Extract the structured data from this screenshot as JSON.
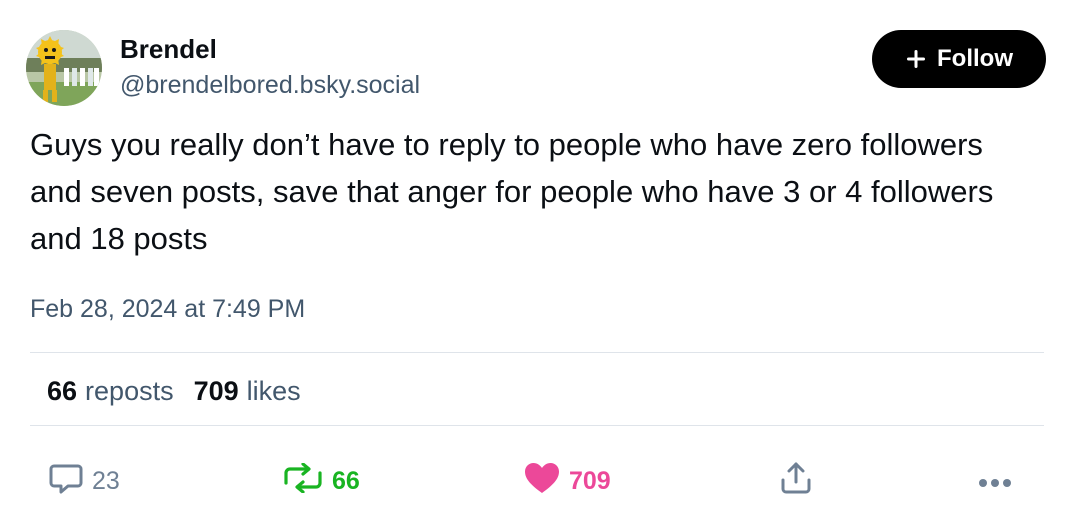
{
  "author": {
    "display_name": "Brendel",
    "handle": "@brendelbored.bsky.social",
    "avatar_icon": "avatar-image"
  },
  "follow_button": {
    "label": "Follow",
    "icon": "plus-icon"
  },
  "post": {
    "text": "Guys you really don’t have to reply to people who have zero followers and seven posts, save that anger for people who have 3 or 4 followers and 18 posts",
    "timestamp": "Feb 28, 2024 at 7:49 PM"
  },
  "stats": {
    "reposts_count": "66",
    "reposts_label": "reposts",
    "likes_count": "709",
    "likes_label": "likes"
  },
  "actions": {
    "reply": {
      "icon": "speech-bubble-icon",
      "count": "23",
      "color": "#6f8094"
    },
    "repost": {
      "icon": "repost-icon",
      "count": "66",
      "color": "#19b422"
    },
    "like": {
      "icon": "heart-icon",
      "count": "709",
      "color": "#ec4899"
    },
    "share": {
      "icon": "share-icon"
    },
    "more": {
      "icon": "ellipsis-icon"
    }
  },
  "colors": {
    "text_primary": "#0b0f14",
    "text_secondary": "#42576c",
    "divider": "#dfe4ea",
    "follow_bg": "#000000"
  }
}
